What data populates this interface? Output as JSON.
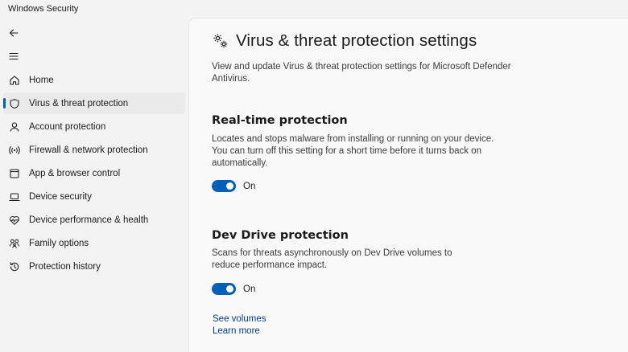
{
  "window": {
    "title": "Windows Security"
  },
  "sidebar": {
    "items": [
      {
        "label": "Home",
        "icon": "home-icon",
        "selected": false
      },
      {
        "label": "Virus & threat protection",
        "icon": "shield-icon",
        "selected": true
      },
      {
        "label": "Account protection",
        "icon": "person-icon",
        "selected": false
      },
      {
        "label": "Firewall & network protection",
        "icon": "wireless-icon",
        "selected": false
      },
      {
        "label": "App & browser control",
        "icon": "app-window-icon",
        "selected": false
      },
      {
        "label": "Device security",
        "icon": "laptop-icon",
        "selected": false
      },
      {
        "label": "Device performance & health",
        "icon": "heart-pulse-icon",
        "selected": false
      },
      {
        "label": "Family options",
        "icon": "family-icon",
        "selected": false
      },
      {
        "label": "Protection history",
        "icon": "history-icon",
        "selected": false
      }
    ]
  },
  "main": {
    "title": "Virus & threat protection settings",
    "description": "View and update Virus & threat protection settings for Microsoft Defender Antivirus.",
    "sections": [
      {
        "title": "Real-time protection",
        "description": "Locates and stops malware from installing or running on your device. You can turn off this setting for a short time before it turns back on automatically.",
        "toggle_label": "On",
        "toggle_on": true
      },
      {
        "title": "Dev Drive protection",
        "description": "Scans for threats asynchronously on Dev Drive volumes to reduce performance impact.",
        "toggle_label": "On",
        "toggle_on": true
      }
    ],
    "links": {
      "see_volumes": "See volumes",
      "learn_more": "Learn more"
    }
  },
  "colors": {
    "accent": "#005fb8",
    "link": "#003e92"
  }
}
